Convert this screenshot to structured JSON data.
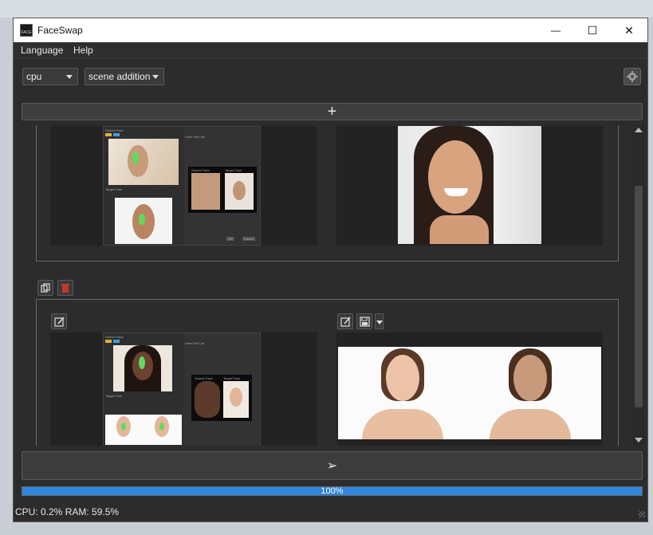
{
  "window": {
    "title": "FaceSwap",
    "app_icon_text": "FACE"
  },
  "title_buttons": {
    "minimize": "—",
    "maximize": "☐",
    "close": "✕"
  },
  "menu": {
    "items": [
      "Language",
      "Help"
    ]
  },
  "toolbar": {
    "device": "cpu",
    "mode": "scene addition"
  },
  "add_button": {
    "label": "+"
  },
  "scene1": {
    "preview_source_label": "Source Face",
    "preview_target_label": "Target Face",
    "preview_panel_label": "Face Pair List",
    "mini_source": "Source Face",
    "mini_target": "Target Face",
    "mini_ok": "OK",
    "mini_cancel": "Cancel"
  },
  "scene2": {
    "preview_source_label": "Source Face",
    "preview_target_label": "Target Face",
    "preview_panel_label": "Face Pair List",
    "mini_source": "Source Face",
    "mini_target": "Target Face"
  },
  "run_button": {
    "label": "➢"
  },
  "progress": {
    "value": 1.0,
    "label": "100%"
  },
  "status": {
    "text": "CPU: 0.2%  RAM: 59.5%"
  },
  "colors": {
    "progress": "#2f86de",
    "delete_button": "#c0392b",
    "face_marker": "#5fdc5f"
  }
}
